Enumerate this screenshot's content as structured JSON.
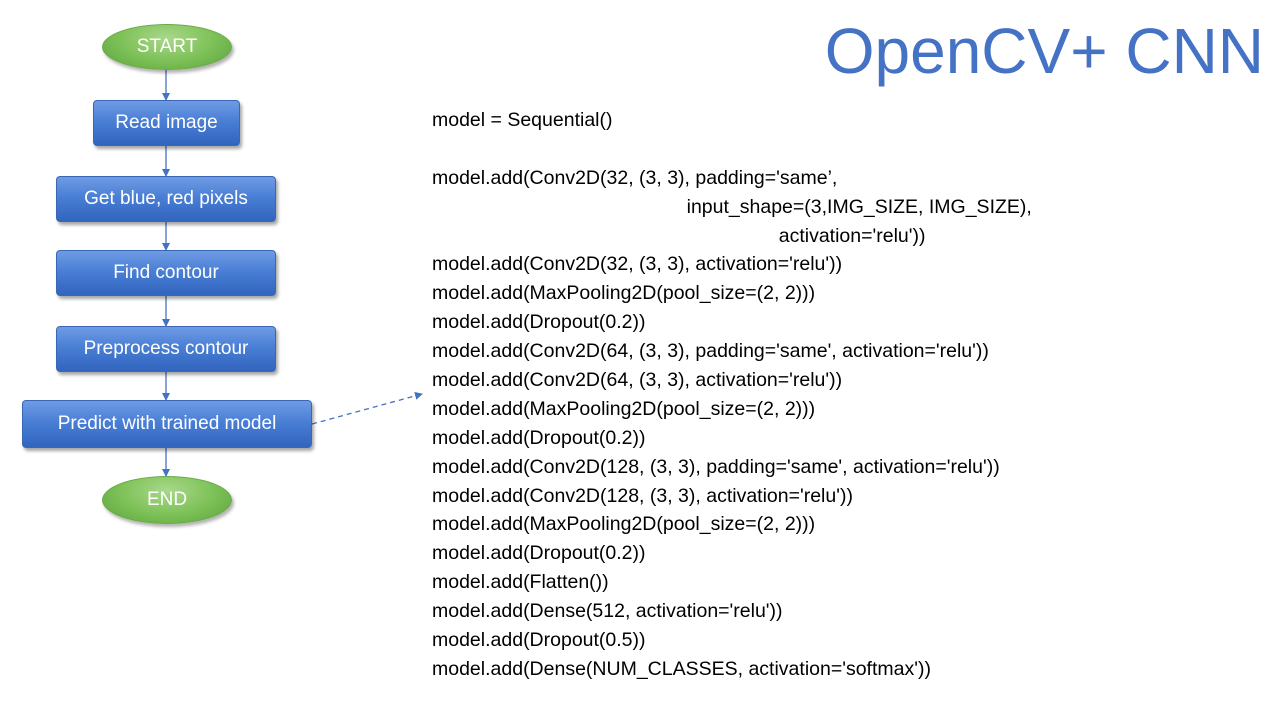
{
  "slide": {
    "title": "OpenCV+ CNN"
  },
  "flowchart": {
    "start_label": "START",
    "end_label": "END",
    "steps": [
      {
        "label": "Read image"
      },
      {
        "label": "Get blue, red pixels"
      },
      {
        "label": "Find contour"
      },
      {
        "label": "Preprocess contour"
      },
      {
        "label": "Predict with trained model"
      }
    ],
    "colors": {
      "process_fill": "#4a7fd6",
      "terminal_fill": "#7fc25a",
      "connector": "#4472C4",
      "title": "#4472C4"
    }
  },
  "code": {
    "lines": [
      "model = Sequential()",
      "",
      "model.add(Conv2D(32, (3, 3), padding='same’,",
      "                                               input_shape=(3,IMG_SIZE, IMG_SIZE),",
      "                                                                activation='relu'))",
      "model.add(Conv2D(32, (3, 3), activation='relu'))",
      "model.add(MaxPooling2D(pool_size=(2, 2)))",
      "model.add(Dropout(0.2))",
      "model.add(Conv2D(64, (3, 3), padding='same', activation='relu'))",
      "model.add(Conv2D(64, (3, 3), activation='relu'))",
      "model.add(MaxPooling2D(pool_size=(2, 2)))",
      "model.add(Dropout(0.2))",
      "model.add(Conv2D(128, (3, 3), padding='same', activation='relu'))",
      "model.add(Conv2D(128, (3, 3), activation='relu'))",
      "model.add(MaxPooling2D(pool_size=(2, 2)))",
      "model.add(Dropout(0.2))",
      "model.add(Flatten())",
      "model.add(Dense(512, activation='relu'))",
      "model.add(Dropout(0.5))",
      "model.add(Dense(NUM_CLASSES, activation='softmax'))"
    ]
  }
}
